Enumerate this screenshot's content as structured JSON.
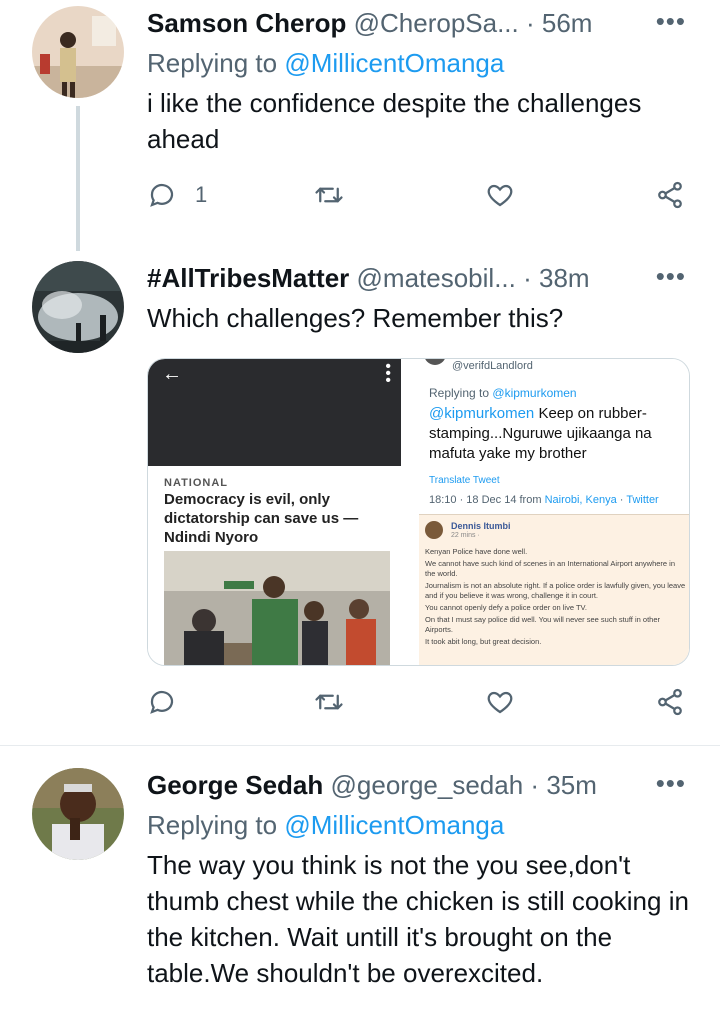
{
  "tweets": [
    {
      "name": "Samson Cherop",
      "handle": "@CheropSa...",
      "dot": "·",
      "time": "56m",
      "more": "•••",
      "replying_prefix": "Replying to",
      "replying_to": "@MillicentOmanga",
      "text": "i like the confidence despite the challenges ahead",
      "reply_count": "1"
    },
    {
      "name": "#AllTribesMatter",
      "handle": "@matesobil...",
      "dot": "·",
      "time": "38m",
      "more": "•••",
      "text": "Which challenges? Remember this?",
      "media": {
        "left": {
          "back_icon": "←",
          "section": "NATIONAL",
          "headline": "Democracy is evil, only dictatorship can save us — Ndindi Nyoro"
        },
        "right": {
          "handle": "@verifdLandlord",
          "replying_prefix": "Replying to",
          "replying_to": "@kipmurkomen",
          "mention": "@kipmurkomen",
          "body": "Keep on rubber-stamping...Nguruwe ujikaanga na mafuta yake my brother",
          "translate": "Translate Tweet",
          "meta_time": "18:10 · 18 Dec 14 from",
          "meta_place": "Nairobi, Kenya",
          "meta_sep": "·",
          "meta_client": "Twitter",
          "fb_name": "Dennis Itumbi",
          "fb_meta": "22 mins ·",
          "fb_lines": [
            "Kenyan Police have done well.",
            "We cannot have such kind of scenes in an International Airport anywhere in the world.",
            "Journalism is not an absolute right. If a police order is lawfully given, you leave and if you believe it was wrong, challenge it in court.",
            "You cannot openly defy a police order on live TV.",
            "On that I must say police did well. You will never see such stuff in other Airports.",
            "It took abit long, but great decision."
          ]
        }
      }
    },
    {
      "name": "George Sedah",
      "handle": "@george_sedah",
      "dot": "·",
      "time": "35m",
      "more": "•••",
      "replying_prefix": "Replying to",
      "replying_to": "@MillicentOmanga",
      "text": "The way you think is not the you see,don't thumb chest while the chicken is still cooking in the kitchen. Wait untill it's brought on the table.We shouldn't be overexcited."
    }
  ],
  "icons": [
    "reply-icon",
    "retweet-icon",
    "like-icon",
    "share-icon",
    "more-icon"
  ],
  "colors": {
    "text": "#0f1419",
    "secondary": "#536471",
    "link": "#1d9bf0",
    "divider": "#e7ebee",
    "thread_line": "#cfd9de"
  }
}
